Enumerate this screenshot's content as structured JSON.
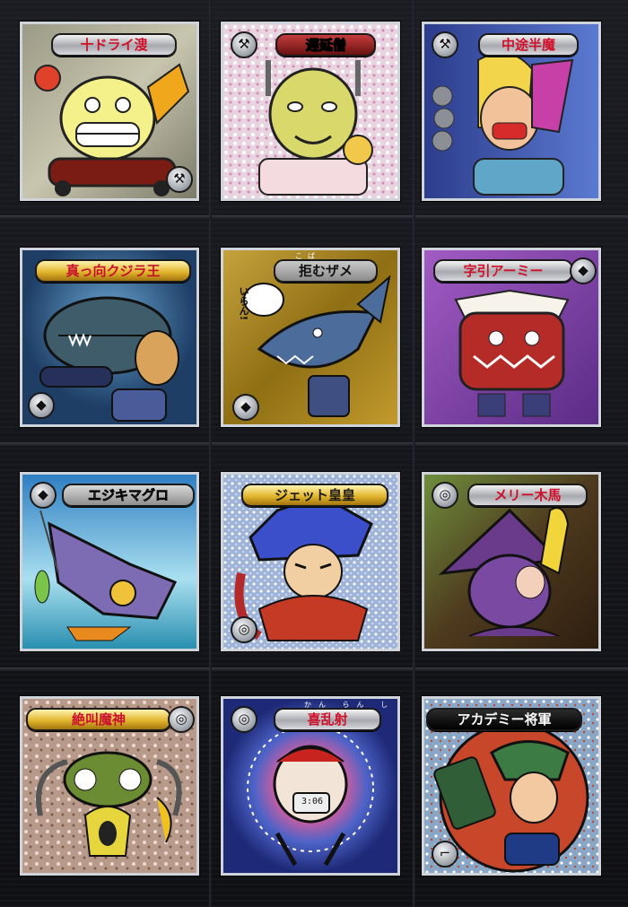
{
  "cards": [
    {
      "name": "十ドライ溲",
      "emblem": "hammer-icon"
    },
    {
      "name": "遅延僧",
      "emblem": "hammer-icon"
    },
    {
      "name": "中途半魔",
      "emblem": "hammer-icon"
    },
    {
      "name": "真っ向クジラ王",
      "emblem": "fish-icon"
    },
    {
      "name": "拒むザメ",
      "furigana": "こば",
      "emblem": "fish-icon",
      "speech": "いらん!"
    },
    {
      "name": "字引アーミー",
      "emblem": "fish-icon"
    },
    {
      "name": "エジキマグロ",
      "emblem": "fish-icon"
    },
    {
      "name": "ジェット皇皇",
      "emblem": "spiral-icon"
    },
    {
      "name": "メリー木馬",
      "emblem": "spiral-icon"
    },
    {
      "name": "絶叫魔神",
      "emblem": "spiral-icon"
    },
    {
      "name": "喜乱射",
      "furigana": "かん らん しゃ",
      "emblem": "spiral-icon",
      "clock": "3:06"
    },
    {
      "name": "アカデミー将軍",
      "emblem": "hook-icon"
    }
  ]
}
